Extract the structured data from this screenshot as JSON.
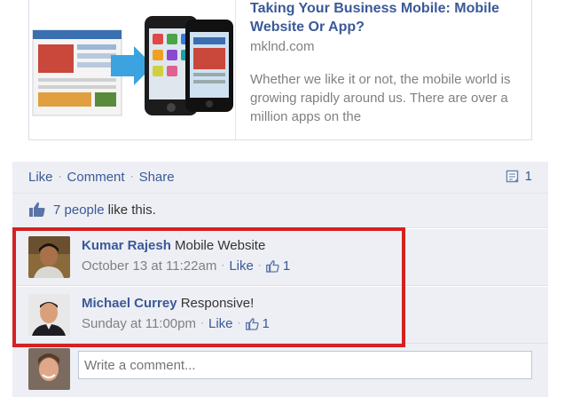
{
  "preview": {
    "title": "Taking Your Business Mobile: Mobile Website Or App?",
    "domain": "mklnd.com",
    "description": "Whether we like it or not, the mobile world is growing rapidly around us. There are over a million apps on the"
  },
  "actions": {
    "like": "Like",
    "comment": "Comment",
    "share": "Share",
    "comment_count": "1"
  },
  "likes": {
    "count_text": "7 people",
    "suffix": "like this."
  },
  "comments": [
    {
      "author": "Kumar Rajesh",
      "text": "Mobile Website",
      "time": "October 13 at 11:22am",
      "like": "Like",
      "likes": "1"
    },
    {
      "author": "Michael Currey",
      "text": "Responsive!",
      "time": "Sunday at 11:00pm",
      "like": "Like",
      "likes": "1"
    }
  ],
  "composer": {
    "placeholder": "Write a comment..."
  },
  "colors": {
    "link": "#3b5998",
    "highlight": "#d42121",
    "feedback_bg": "#edeff4"
  }
}
